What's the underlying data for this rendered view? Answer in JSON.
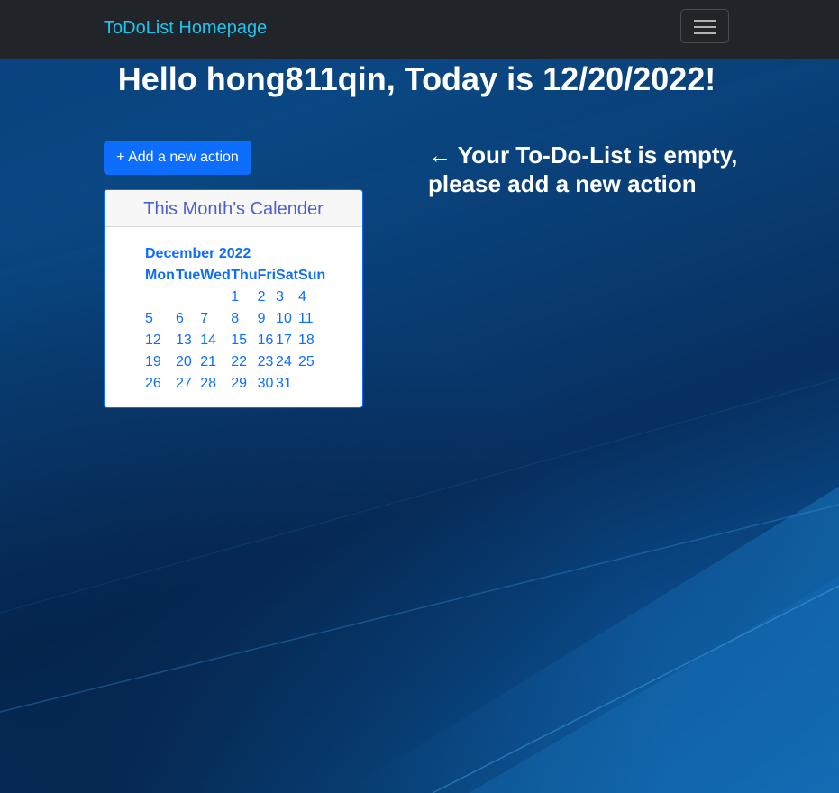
{
  "navbar": {
    "brand": "ToDoList Homepage",
    "toggler_icon": "hamburger-menu-icon"
  },
  "greeting": "Hello hong811qin, Today is 12/20/2022!",
  "add_button": {
    "label": "+ Add a new action"
  },
  "calendar": {
    "header": "This Month's Calender",
    "month": "December 2022",
    "weekdays": [
      "Mon",
      "Tue",
      "Wed",
      "Thu",
      "Fri",
      "Sat",
      "Sun"
    ],
    "weeks": [
      [
        "",
        "",
        "",
        "1",
        "2",
        "3",
        "4"
      ],
      [
        "5",
        "6",
        "7",
        "8",
        "9",
        "10",
        "11"
      ],
      [
        "12",
        "13",
        "14",
        "15",
        "16",
        "17",
        "18"
      ],
      [
        "19",
        "20",
        "21",
        "22",
        "23",
        "24",
        "25"
      ],
      [
        "26",
        "27",
        "28",
        "29",
        "30",
        "31",
        ""
      ]
    ]
  },
  "empty_message": {
    "arrow": "←",
    "text": "Your To-Do-List is empty, please add a new action"
  },
  "colors": {
    "navbar_bg": "#212529",
    "brand": "#1fc4f0",
    "button": "#0d6efd",
    "calendar_text": "#0d6efd",
    "calendar_header_text": "#4a5fd6"
  }
}
